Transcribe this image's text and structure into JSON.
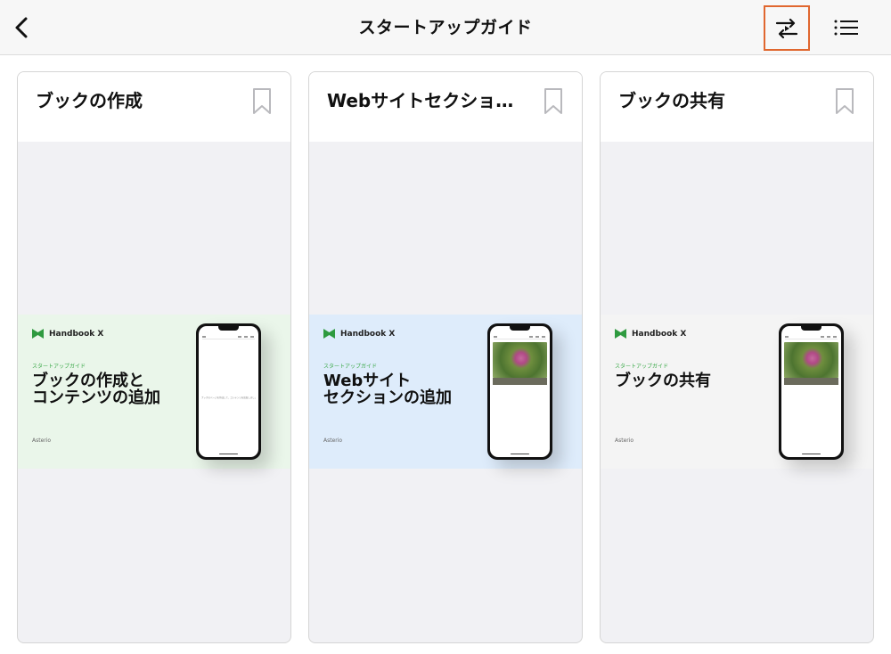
{
  "nav": {
    "title": "スタートアップガイド",
    "icons": {
      "back": "chevron-left-icon",
      "slideshow": "slideshow-swap-icon",
      "menu": "list-menu-icon"
    },
    "highlight_color": "#e0672f"
  },
  "cards": [
    {
      "title": "ブックの作成",
      "bookmark_icon": "bookmark-icon",
      "banner": {
        "bg": "#eaf6ea",
        "brand": "Handbook X",
        "subtitle": "スタートアップガイド",
        "headline_lines": [
          "ブックの作成と",
          "コンテンツの追加"
        ],
        "footer_logo": "Asterio",
        "phone_text": "ブックのページを作成して、コンテンツを追加しましょう"
      }
    },
    {
      "title": "Webサイトセクショ…",
      "bookmark_icon": "bookmark-icon",
      "banner": {
        "bg": "#deecfb",
        "brand": "Handbook X",
        "subtitle": "スタートアップガイド",
        "headline_lines": [
          "Webサイト",
          "セクションの追加"
        ],
        "footer_logo": "Asterio"
      }
    },
    {
      "title": "ブックの共有",
      "bookmark_icon": "bookmark-icon",
      "banner": {
        "bg": "#f4f4f4",
        "brand": "Handbook X",
        "subtitle": "スタートアップガイド",
        "headline_lines": [
          "ブックの共有"
        ],
        "footer_logo": "Asterio"
      }
    }
  ]
}
